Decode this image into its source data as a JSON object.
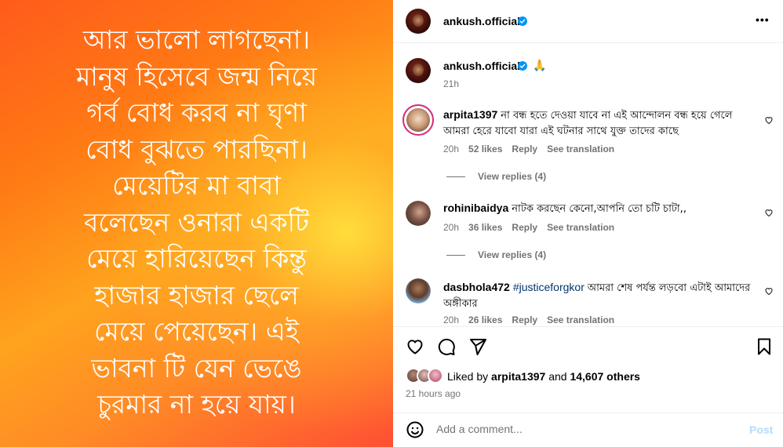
{
  "post_image": {
    "lines": [
      "আর ভালো লাগছেনা।",
      "মানুষ হিসেবে জন্ম নিয়ে",
      "গর্ব বোধ করব না ঘৃণা",
      "বোধ বুঝতে পারছিনা।",
      "মেয়েটির মা বাবা",
      "বলেছেন ওনারা একটি",
      "মেয়ে হারিয়েছেন কিন্তু",
      "হাজার হাজার ছেলে",
      "মেয়ে পেয়েছেন। এই",
      "ভাবনা টি যেন ভেঙে",
      "চুরমার না হয়ে যায়।"
    ]
  },
  "header": {
    "username": "ankush.official",
    "more_label": "•••"
  },
  "caption": {
    "username": "ankush.official",
    "emoji": "🙏",
    "time": "21h"
  },
  "comments": [
    {
      "username": "arpita1397",
      "text": "না বন্ধ হতে দেওয়া যাবে না এই আন্দোলন বন্ধ হয়ে গেলে আমরা হেরে যাবো যারা এই ঘটনার সাথে যুক্ত তাদের কাছে",
      "time": "20h",
      "likes": "52 likes",
      "reply": "Reply",
      "translate": "See translation",
      "view_replies": "View replies (4)"
    },
    {
      "username": "rohinibaidya",
      "text": "নাটক করছেন কেনো,আপনি তো চটি চাটা,,",
      "time": "20h",
      "likes": "36 likes",
      "reply": "Reply",
      "translate": "See translation",
      "view_replies": "View replies (4)"
    },
    {
      "username": "dasbhola472",
      "hashtag": "#justiceforgkor",
      "text": "আমরা শেষ পর্যন্ত লড়বো এটাই আমাদের অঙ্গীকার",
      "time": "20h",
      "likes": "26 likes",
      "reply": "Reply",
      "translate": "See translation"
    }
  ],
  "likes_summary": {
    "prefix": "Liked by",
    "user": "arpita1397",
    "middle": "and",
    "count": "14,607 others",
    "time": "21 hours ago"
  },
  "add_comment": {
    "placeholder": "Add a comment...",
    "post_label": "Post"
  },
  "colors": {
    "verified": "#0095f6",
    "link": "#00376b",
    "muted": "#737373",
    "post_disabled": "#b3dbff"
  }
}
